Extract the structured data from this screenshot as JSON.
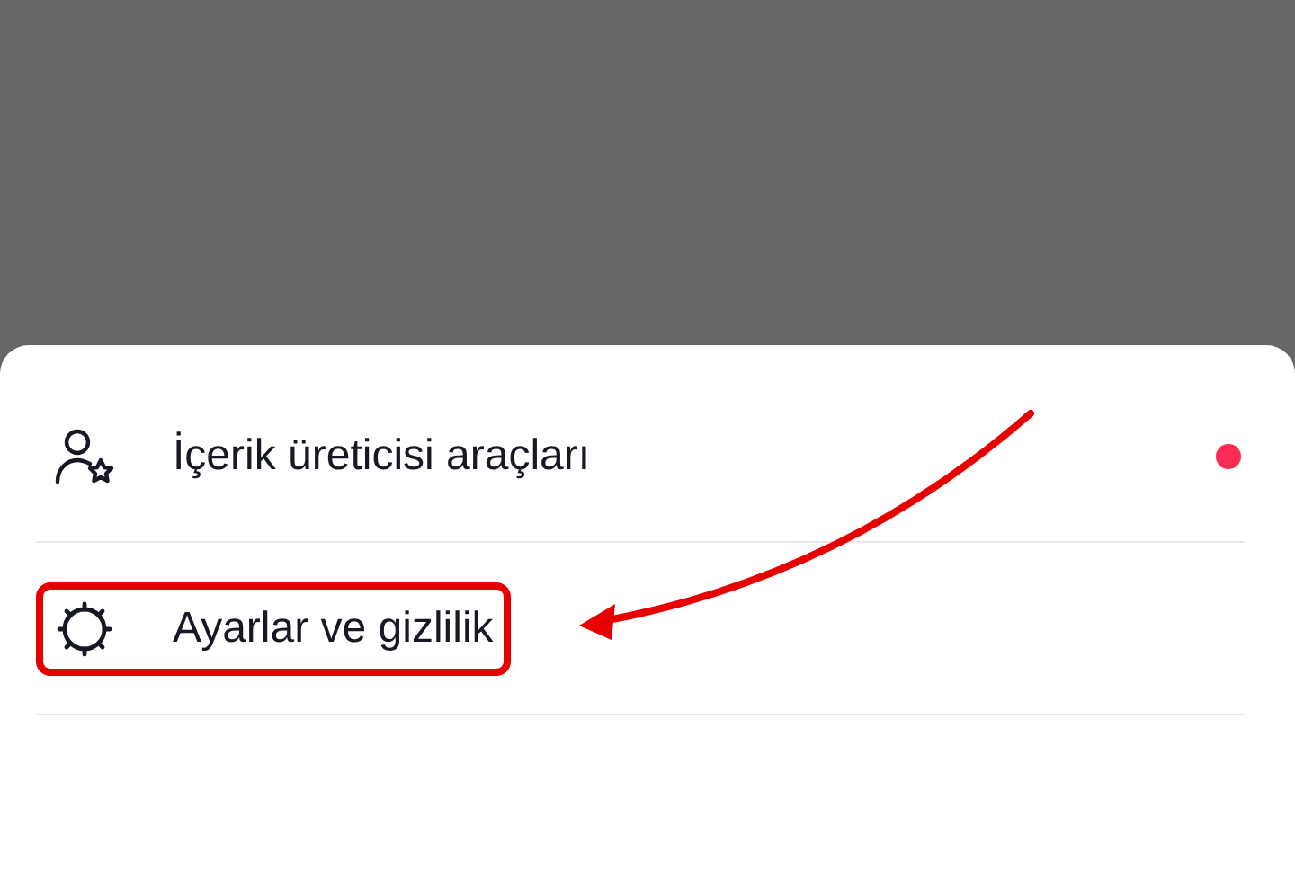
{
  "menu": {
    "items": [
      {
        "kind": "creator",
        "label": "İçerik üreticisi araçları",
        "badge": true,
        "highlighted": false
      },
      {
        "kind": "settings",
        "label": "Ayarlar ve gizlilik",
        "badge": false,
        "highlighted": true
      }
    ]
  }
}
